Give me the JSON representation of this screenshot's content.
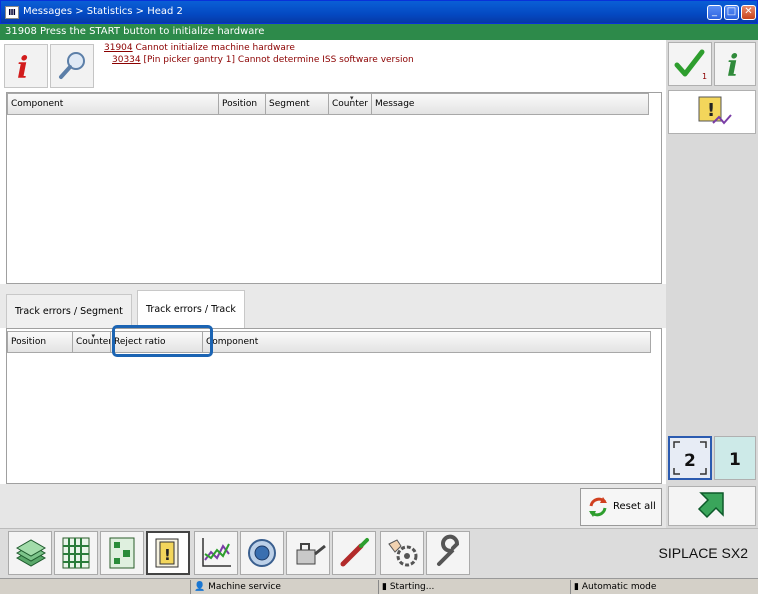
{
  "window": {
    "title": "Messages > Statistics > Head 2",
    "app_icon": "Ⅲ",
    "minimize": "_",
    "maximize": "□",
    "close": "✕"
  },
  "status_line": "31908 Press the START button to initialize hardware",
  "messages": [
    {
      "code": "31904",
      "text": " Cannot initialize machine hardware"
    },
    {
      "code": "30334",
      "text": " [Pin picker gantry 1] Cannot determine ISS software version"
    }
  ],
  "right_icons": {
    "check_count": "1"
  },
  "component_table": {
    "columns": [
      "Component",
      "Position",
      "Segment",
      "Counter",
      "Message"
    ],
    "sort_marker": "▾"
  },
  "tabs": [
    {
      "label": "Track errors / Segment",
      "active": false
    },
    {
      "label": "Track errors / Track",
      "active": true
    }
  ],
  "track_table": {
    "columns": [
      "Position",
      "Counter",
      "Reject ratio",
      "Component"
    ],
    "sort_marker": "▾"
  },
  "head_selector": {
    "head2": "2",
    "head1": "1"
  },
  "reset_label": "Reset all",
  "brand": "SIPLACE SX2",
  "status_bar": {
    "user": "Machine service",
    "state": "Starting...",
    "mode": "Automatic mode"
  },
  "colors": {
    "status_green": "#2d8a4a",
    "highlight_blue": "#1b64b3",
    "message_red": "#8b0000"
  }
}
